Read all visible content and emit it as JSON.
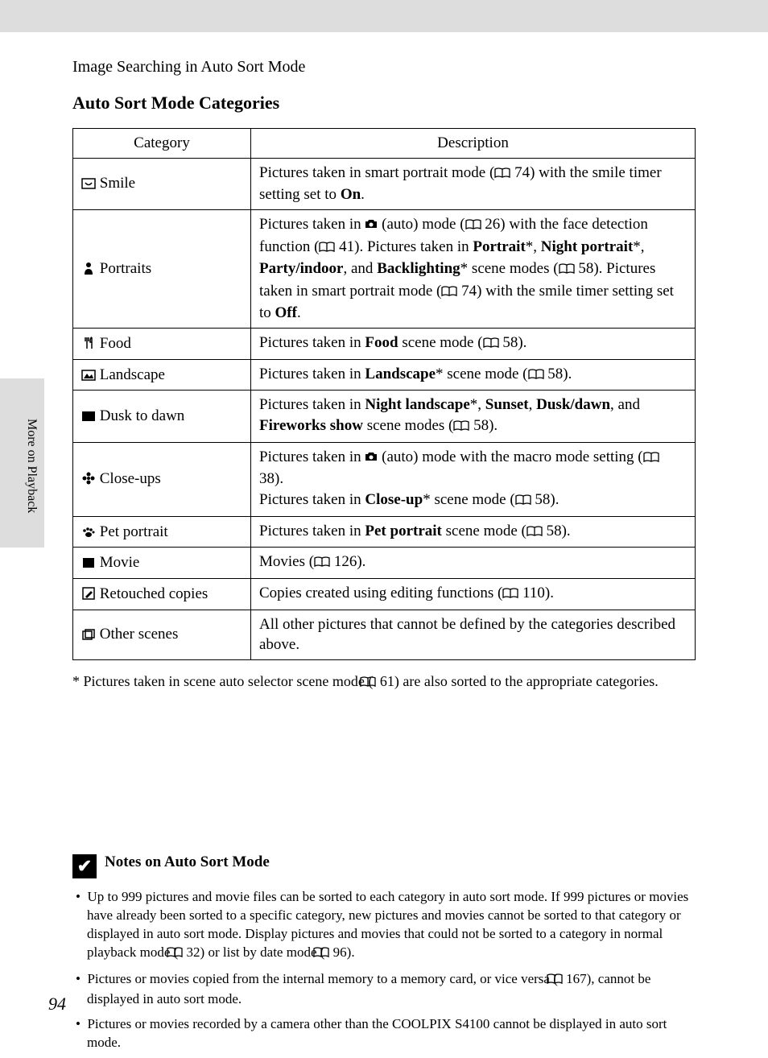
{
  "section_label": "Image Searching in Auto Sort Mode",
  "side_label": "More on Playback",
  "main_title": "Auto Sort Mode Categories",
  "header": {
    "category": "Category",
    "description": "Description"
  },
  "rows": [
    {
      "name": "Smile",
      "desc": [
        {
          "t": "Pictures taken in smart portrait mode ("
        },
        {
          "ref": "74"
        },
        {
          "t": ") with the smile timer setting set to "
        },
        {
          "b": "On"
        },
        {
          "t": "."
        }
      ]
    },
    {
      "name": "Portraits",
      "desc": [
        {
          "t": "Pictures taken in "
        },
        {
          "cam": true
        },
        {
          "t": " (auto) mode ("
        },
        {
          "ref": "26"
        },
        {
          "t": ") with the face detection function ("
        },
        {
          "ref": "41"
        },
        {
          "t": "). Pictures taken in "
        },
        {
          "b": "Portrait"
        },
        {
          "t": "*, "
        },
        {
          "b": "Night portrait"
        },
        {
          "t": "*, "
        },
        {
          "b": "Party/indoor"
        },
        {
          "t": ", and "
        },
        {
          "b": "Backlighting"
        },
        {
          "t": "* scene modes ("
        },
        {
          "ref": "58"
        },
        {
          "t": "). Pictures taken in smart portrait mode ("
        },
        {
          "ref": "74"
        },
        {
          "t": ") with the smile timer setting set to "
        },
        {
          "b": "Off"
        },
        {
          "t": "."
        }
      ]
    },
    {
      "name": "Food",
      "desc": [
        {
          "t": "Pictures taken in "
        },
        {
          "b": "Food"
        },
        {
          "t": " scene mode ("
        },
        {
          "ref": "58"
        },
        {
          "t": ")."
        }
      ]
    },
    {
      "name": "Landscape",
      "desc": [
        {
          "t": "Pictures taken in "
        },
        {
          "b": "Landscape"
        },
        {
          "t": "* scene mode ("
        },
        {
          "ref": "58"
        },
        {
          "t": ")."
        }
      ]
    },
    {
      "name": "Dusk to dawn",
      "desc": [
        {
          "t": "Pictures taken in "
        },
        {
          "b": "Night landscape"
        },
        {
          "t": "*, "
        },
        {
          "b": "Sunset"
        },
        {
          "t": ", "
        },
        {
          "b": "Dusk/dawn"
        },
        {
          "t": ", and "
        },
        {
          "b": "Fireworks show"
        },
        {
          "t": " scene modes ("
        },
        {
          "ref": "58"
        },
        {
          "t": ")."
        }
      ]
    },
    {
      "name": "Close-ups",
      "desc": [
        {
          "t": "Pictures taken in "
        },
        {
          "cam": true
        },
        {
          "t": " (auto) mode with the macro mode setting ("
        },
        {
          "ref": "38"
        },
        {
          "t": ").\nPictures taken in "
        },
        {
          "b": "Close-up"
        },
        {
          "t": "* scene mode ("
        },
        {
          "ref": "58"
        },
        {
          "t": ")."
        }
      ]
    },
    {
      "name": "Pet portrait",
      "desc": [
        {
          "t": "Pictures taken in "
        },
        {
          "b": "Pet portrait"
        },
        {
          "t": " scene mode ("
        },
        {
          "ref": "58"
        },
        {
          "t": ")."
        }
      ]
    },
    {
      "name": "Movie",
      "desc": [
        {
          "t": "Movies ("
        },
        {
          "ref": "126"
        },
        {
          "t": ")."
        }
      ]
    },
    {
      "name": "Retouched copies",
      "desc": [
        {
          "t": "Copies created using editing functions ("
        },
        {
          "ref": "110"
        },
        {
          "t": ")."
        }
      ]
    },
    {
      "name": "Other scenes",
      "desc": [
        {
          "t": "All other pictures that cannot be defined by the categories described above."
        }
      ]
    }
  ],
  "footnote": [
    {
      "t": "*  Pictures taken in scene auto selector scene mode ("
    },
    {
      "ref": "61"
    },
    {
      "t": ") are also sorted to the appropriate categories."
    }
  ],
  "notes_title": "Notes on Auto Sort Mode",
  "notes": [
    [
      {
        "t": "Up to 999 pictures and movie files can be sorted to each category in auto sort mode. If 999 pictures or movies have already been sorted to a specific category, new pictures and movies cannot be sorted to that category or displayed in auto sort mode. Display pictures and movies that could not be sorted to a category in normal playback mode ("
      },
      {
        "ref": "32"
      },
      {
        "t": ") or list by date mode ("
      },
      {
        "ref": "96"
      },
      {
        "t": ")."
      }
    ],
    [
      {
        "t": "Pictures or movies copied from the internal memory to a memory card, or vice versa ("
      },
      {
        "ref": "167"
      },
      {
        "t": "), cannot be displayed in auto sort mode."
      }
    ],
    [
      {
        "t": "Pictures or movies recorded by a camera other than the COOLPIX S4100 cannot be displayed in auto sort mode."
      }
    ]
  ],
  "page_number": "94",
  "icons": {
    "Smile": "smile",
    "Portraits": "person",
    "Food": "fork",
    "Landscape": "mountain",
    "Dusk to dawn": "moon",
    "Close-ups": "flower",
    "Pet portrait": "paw",
    "Movie": "film",
    "Retouched copies": "retouch",
    "Other scenes": "other"
  }
}
